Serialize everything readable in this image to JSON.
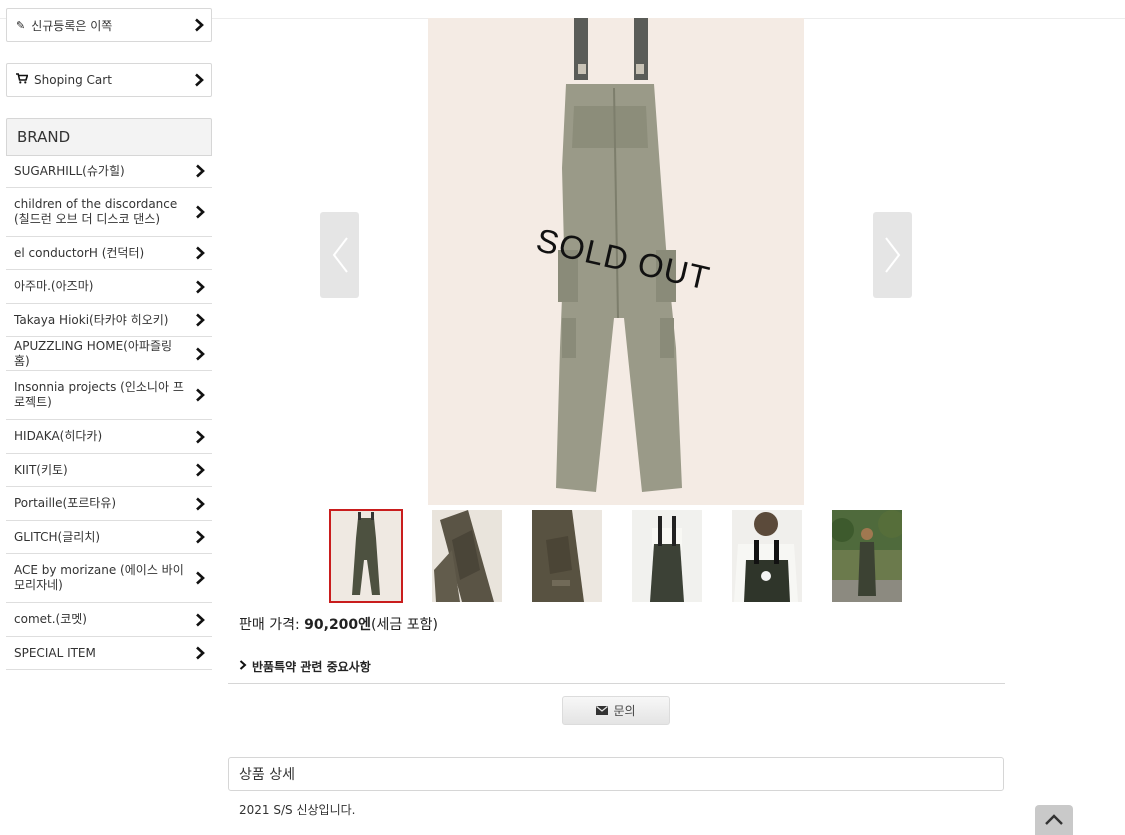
{
  "sidebar": {
    "register_label": "신규등록은 이쪽",
    "cart_label": "Shoping Cart",
    "brand_heading": "BRAND",
    "brands": [
      "SUGARHILL(슈가힐)",
      "children of the discordance (칠드런 오브 더 디스코 댄스)",
      "el conductorH (컨덕터)",
      "아주마.(아즈마)",
      "Takaya Hioki(타카야 히오키)",
      "APUZZLING HOME(아파즐링홈)",
      "Insonnia projects (인소니아 프로젝트)",
      "HIDAKA(히다카)",
      "KIIT(키토)",
      "Portaille(포르타유)",
      "GLITCH(글리치)",
      "ACE by morizane (에이스 바이 모리자네)",
      "comet.(코멧)",
      "SPECIAL ITEM"
    ]
  },
  "product": {
    "sold_out_label": "SOLD OUT",
    "price_prefix": "판매 가격: ",
    "price_value": "90,200엔",
    "price_suffix": "(세금 포함)",
    "thumbnail_count": 6,
    "selected_thumbnail": 1
  },
  "notice_label": "반품특약 관련 중요사항",
  "inquiry_label": "문의",
  "detail": {
    "heading": "상품 상세",
    "text": "2021 S/S 신상입니다."
  },
  "colors": {
    "selected_outline": "#c91d1d",
    "garment": "#4d5140"
  }
}
